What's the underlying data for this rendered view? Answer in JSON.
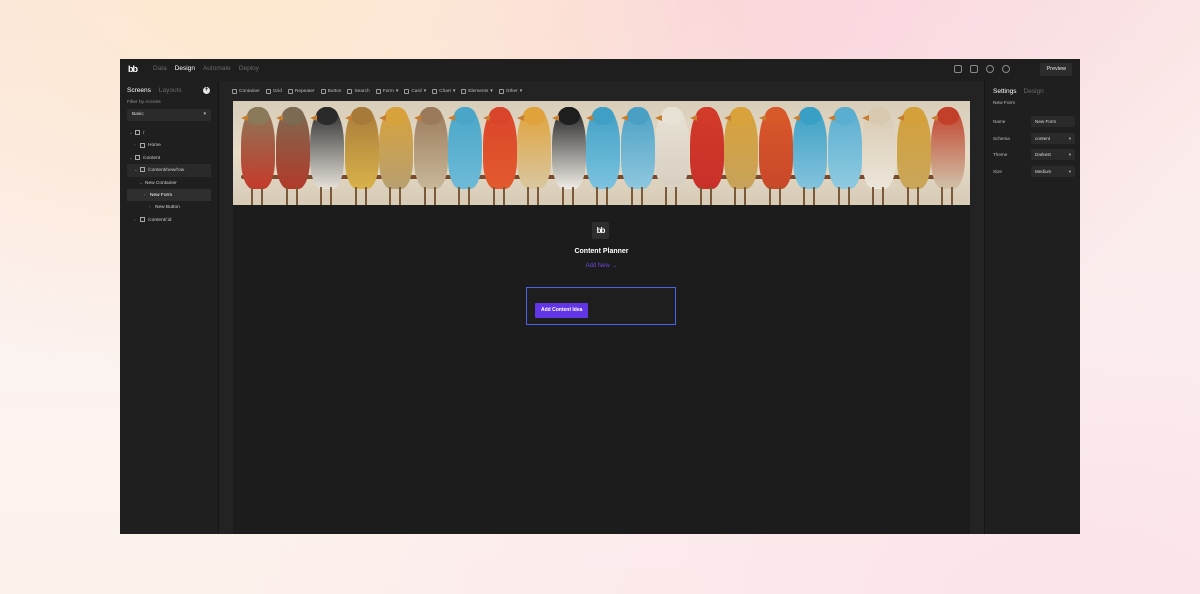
{
  "topbar": {
    "logo": "bb",
    "nav": [
      "Data",
      "Design",
      "Automate",
      "Deploy"
    ],
    "active_nav": "Design",
    "icons": [
      "paint-bucket-icon",
      "chat-icon",
      "github-icon",
      "settings-icon"
    ],
    "preview_label": "Preview"
  },
  "left_panel": {
    "tabs": [
      "Screens",
      "Layouts"
    ],
    "active_tab": "Screens",
    "filter_label": "Filter by Access",
    "filter_value": "Basic",
    "tree": [
      {
        "label": "/",
        "level": 0,
        "type": "folder",
        "expanded": true
      },
      {
        "label": "Home",
        "level": 1,
        "type": "screen",
        "expanded": false
      },
      {
        "label": "/content",
        "level": 0,
        "type": "folder",
        "expanded": true
      },
      {
        "label": "/content/new/row",
        "level": 1,
        "type": "screen",
        "expanded": true,
        "selected": true
      },
      {
        "label": "New Container",
        "level": 2,
        "type": "component",
        "expanded": true
      },
      {
        "label": "New Form",
        "level": 3,
        "type": "component",
        "expanded": false,
        "highlighted": true
      },
      {
        "label": "New Button",
        "level": 4,
        "type": "component",
        "expanded": false
      },
      {
        "label": "/content/:id",
        "level": 1,
        "type": "screen",
        "expanded": false
      }
    ]
  },
  "toolbar": {
    "items": [
      {
        "label": "Container",
        "dropdown": false
      },
      {
        "label": "Grid",
        "dropdown": false
      },
      {
        "label": "Repeater",
        "dropdown": false
      },
      {
        "label": "Button",
        "dropdown": false
      },
      {
        "label": "Search",
        "dropdown": false
      },
      {
        "label": "Form",
        "dropdown": true
      },
      {
        "label": "Card",
        "dropdown": true
      },
      {
        "label": "Chart",
        "dropdown": true
      },
      {
        "label": "Elements",
        "dropdown": true
      },
      {
        "label": "Other",
        "dropdown": true
      }
    ]
  },
  "canvas": {
    "banner_image": "row of colorful birds on a perch",
    "logo": "bb",
    "title": "Content Planner",
    "link": "Add New →",
    "form_button": "Add Content Idea"
  },
  "right_panel": {
    "tabs": [
      "Settings",
      "Design"
    ],
    "active_tab": "Settings",
    "component": "New Form",
    "properties": [
      {
        "label": "Name",
        "value": "New Form",
        "dropdown": false
      },
      {
        "label": "Schema",
        "value": "content",
        "dropdown": true
      },
      {
        "label": "Theme",
        "value": "Darkest",
        "dropdown": true
      },
      {
        "label": "Size",
        "value": "Medium",
        "dropdown": true
      }
    ]
  },
  "colors": {
    "accent": "#6236e6",
    "selection_border": "#4b63e8",
    "app_bg": "#232323"
  }
}
